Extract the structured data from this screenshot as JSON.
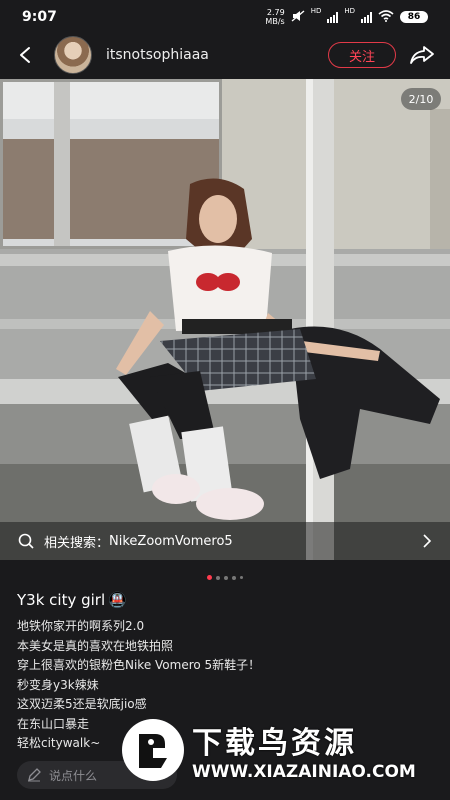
{
  "status_bar": {
    "time": "9:07",
    "net_speed_value": "2.79",
    "net_speed_unit": "MB/s",
    "signal_label": "HD",
    "battery": "86"
  },
  "header": {
    "username": "itsnotsophiaaa",
    "follow_label": "关注"
  },
  "photo": {
    "page_counter": "2/10",
    "related_label": "相关搜索：",
    "related_query": "NikeZoomVomero5"
  },
  "carousel": {
    "count": 5,
    "active_index": 0
  },
  "post": {
    "title": "Y3k city girl",
    "title_emoji": "🚇",
    "lines": [
      "地铁你家开的啊系列2.0",
      "本美女是真的喜欢在地铁拍照",
      "穿上很喜欢的银粉色Nike Vomero 5新鞋子！",
      "秒变身y3k辣妹",
      "这双迈柔5还是软底jio感",
      "在东山口暴走",
      "轻松citywalk~"
    ]
  },
  "comment": {
    "placeholder": "说点什么"
  },
  "watermark": {
    "title": "下载鸟资源",
    "url": "WWW.XIAZAINIAO.COM"
  },
  "colors": {
    "accent": "#ff3b4e",
    "background": "#1a1a1c"
  },
  "icons": [
    "back-arrow-icon",
    "share-icon",
    "search-icon",
    "chevron-right-icon",
    "pencil-icon",
    "wifi-icon",
    "mute-icon"
  ]
}
